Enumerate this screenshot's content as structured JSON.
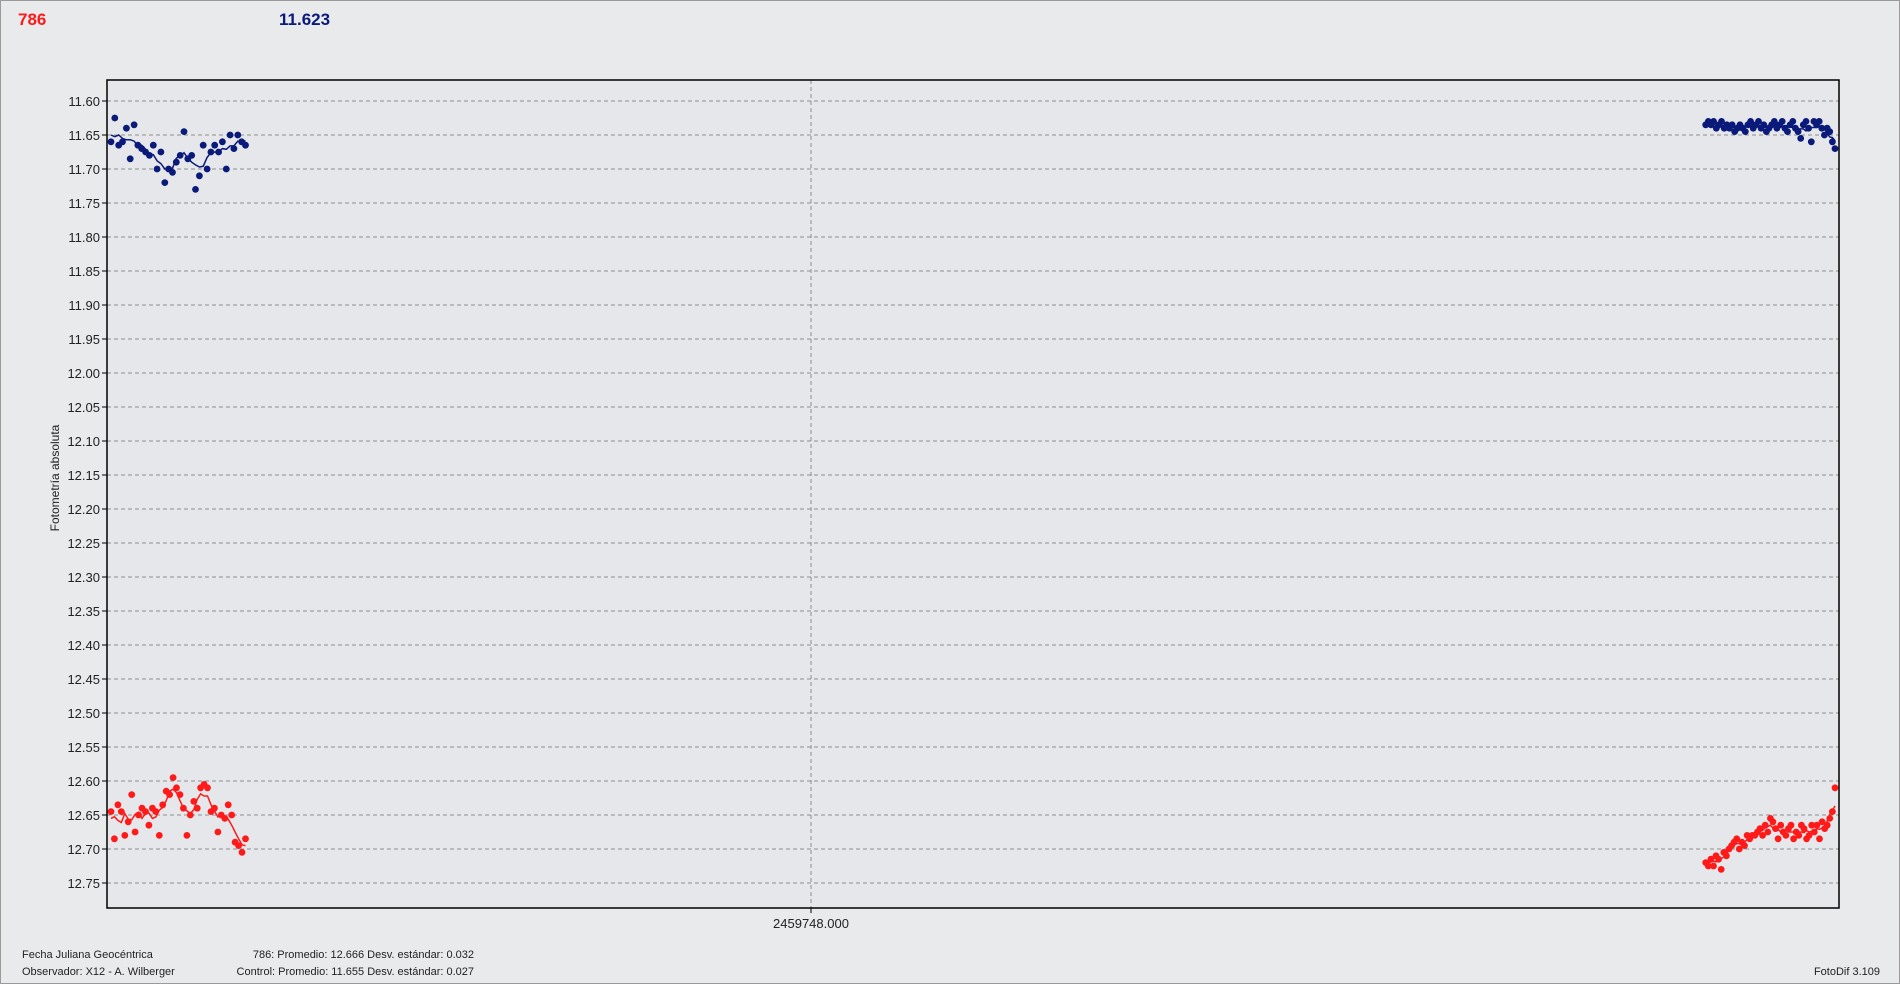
{
  "header": {
    "target_label": "786",
    "control_value": "11.623",
    "target_color": "#ff1a1a",
    "control_color": "#0a1a7a"
  },
  "footer": {
    "date_label": "Fecha Juliana Geocéntrica",
    "observer": "Observador: X12 - A. Wilberger",
    "target_stats": "786: Promedio: 12.666  Desv. estándar: 0.032",
    "control_stats": "Control: Promedio: 11.655  Desv. estándar: 0.027",
    "version": "FotoDif 3.109"
  },
  "chart_data": {
    "type": "scatter",
    "ylabel": "Fotometría absoluta",
    "yticks": [
      "11.60",
      "11.65",
      "11.70",
      "11.75",
      "11.80",
      "11.85",
      "11.90",
      "11.95",
      "12.00",
      "12.05",
      "12.10",
      "12.15",
      "12.20",
      "12.25",
      "12.30",
      "12.35",
      "12.40",
      "12.45",
      "12.50",
      "12.55",
      "12.60",
      "12.65",
      "12.70",
      "12.75"
    ],
    "ylim": [
      11.57,
      12.79
    ],
    "y_inverted": true,
    "xtick": "2459748.000",
    "grid": true,
    "series": [
      {
        "name": "786",
        "color": "#ff1a1a",
        "blocks": [
          {
            "start": 0.0,
            "end": 0.078,
            "values": [
              12.645,
              12.685,
              12.635,
              12.645,
              12.68,
              12.66,
              12.62,
              12.675,
              12.65,
              12.64,
              12.645,
              12.665,
              12.64,
              12.645,
              12.68,
              12.635,
              12.615,
              12.62,
              12.595,
              12.61,
              12.62,
              12.64,
              12.68,
              12.65,
              12.63,
              12.64,
              12.61,
              12.605,
              12.61,
              12.645,
              12.64,
              12.675,
              12.65,
              12.655,
              12.635,
              12.65,
              12.69,
              12.695,
              12.705,
              12.685
            ]
          },
          {
            "start": 0.925,
            "end": 1.0,
            "values": [
              12.72,
              12.725,
              12.715,
              12.725,
              12.71,
              12.715,
              12.73,
              12.705,
              12.71,
              12.7,
              12.695,
              12.69,
              12.685,
              12.7,
              12.69,
              12.695,
              12.68,
              12.685,
              12.68,
              12.68,
              12.675,
              12.67,
              12.68,
              12.665,
              12.675,
              12.655,
              12.66,
              12.67,
              12.685,
              12.665,
              12.675,
              12.68,
              12.67,
              12.665,
              12.685,
              12.675,
              12.68,
              12.665,
              12.67,
              12.685,
              12.68,
              12.665,
              12.675,
              12.665,
              12.685,
              12.66,
              12.67,
              12.665,
              12.655,
              12.645,
              12.61
            ]
          }
        ]
      },
      {
        "name": "Control",
        "color": "#0a1a7a",
        "blocks": [
          {
            "start": 0.0,
            "end": 0.078,
            "values": [
              11.66,
              11.625,
              11.665,
              11.66,
              11.64,
              11.685,
              11.635,
              11.665,
              11.67,
              11.675,
              11.68,
              11.665,
              11.7,
              11.675,
              11.72,
              11.7,
              11.705,
              11.69,
              11.68,
              11.645,
              11.685,
              11.68,
              11.73,
              11.71,
              11.665,
              11.7,
              11.675,
              11.665,
              11.675,
              11.66,
              11.7,
              11.65,
              11.67,
              11.65,
              11.66,
              11.665
            ]
          },
          {
            "start": 0.925,
            "end": 1.0,
            "values": [
              11.635,
              11.63,
              11.635,
              11.63,
              11.64,
              11.635,
              11.63,
              11.64,
              11.635,
              11.64,
              11.635,
              11.645,
              11.64,
              11.635,
              11.64,
              11.645,
              11.635,
              11.63,
              11.64,
              11.635,
              11.63,
              11.64,
              11.635,
              11.645,
              11.64,
              11.635,
              11.63,
              11.64,
              11.635,
              11.63,
              11.64,
              11.645,
              11.635,
              11.63,
              11.64,
              11.645,
              11.655,
              11.635,
              11.63,
              11.64,
              11.66,
              11.63,
              11.635,
              11.63,
              11.64,
              11.65,
              11.64,
              11.645,
              11.66,
              11.67
            ]
          }
        ]
      }
    ]
  }
}
